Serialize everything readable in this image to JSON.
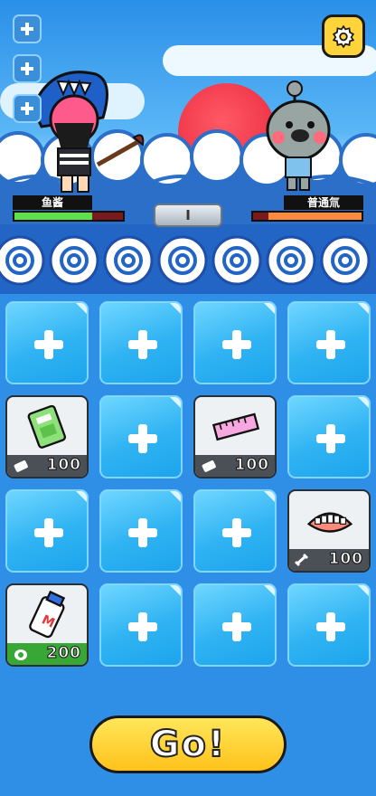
{
  "battle": {
    "player_name": "鱼酱",
    "player_hp_fraction": 0.72,
    "enemy_name": "普通氚",
    "enemy_hp_fraction": 0.86,
    "vs_label": "I",
    "player_hp_color": "#5ee04a",
    "enemy_hp_color": "#ff8a3d"
  },
  "side_buttons": [
    "plus-icon",
    "plus-icon",
    "plus-icon"
  ],
  "settings_icon": "gear-icon",
  "slots": [
    {
      "type": "empty"
    },
    {
      "type": "empty"
    },
    {
      "type": "empty"
    },
    {
      "type": "empty"
    },
    {
      "type": "item",
      "icon": "book-icon",
      "cost_icon": "eraser-icon",
      "cost": "100"
    },
    {
      "type": "empty"
    },
    {
      "type": "item",
      "icon": "ruler-icon",
      "cost_icon": "eraser-icon",
      "cost": "100"
    },
    {
      "type": "empty"
    },
    {
      "type": "empty"
    },
    {
      "type": "empty"
    },
    {
      "type": "empty"
    },
    {
      "type": "item",
      "icon": "dentures-icon",
      "cost_icon": "bone-icon",
      "cost": "100"
    },
    {
      "type": "item",
      "icon": "glue-icon",
      "cost_icon": "footprint-icon",
      "cost": "200",
      "highlight": true
    },
    {
      "type": "empty"
    },
    {
      "type": "empty"
    },
    {
      "type": "empty"
    }
  ],
  "go_button": {
    "label": "Go!"
  }
}
